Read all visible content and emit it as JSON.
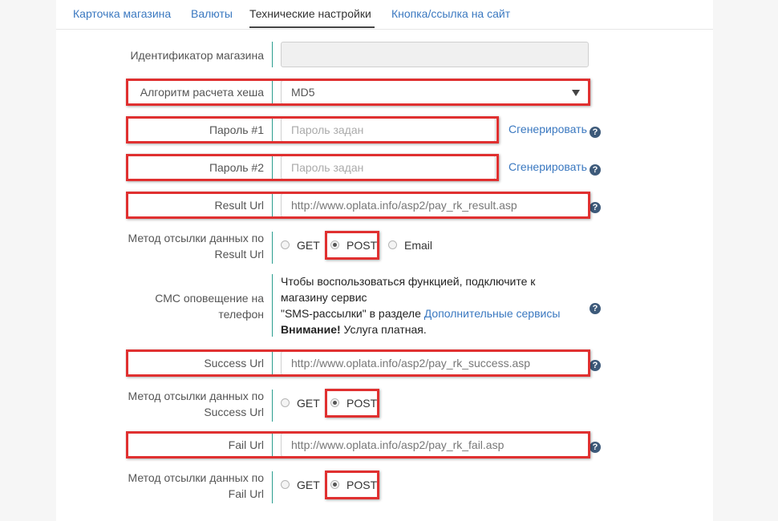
{
  "tabs": [
    "Карточка магазина",
    "Валюты",
    "Технические настройки",
    "Кнопка/ссылка на сайт"
  ],
  "fields": {
    "shop_id": {
      "label": "Идентификатор магазина",
      "value": ""
    },
    "hash_algo": {
      "label": "Алгоритм расчета хеша",
      "value": "MD5"
    },
    "password1": {
      "label": "Пароль #1",
      "placeholder": "Пароль задан",
      "generate": "Сгенерировать"
    },
    "password2": {
      "label": "Пароль #2",
      "placeholder": "Пароль задан",
      "generate": "Сгенерировать"
    },
    "result_url": {
      "label": "Result Url",
      "value": "http://www.oplata.info/asp2/pay_rk_result.asp"
    },
    "result_method": {
      "label_line1": "Метод отсылки данных по",
      "label_line2": "Result Url",
      "options": [
        "GET",
        "POST",
        "Email"
      ],
      "selected": "POST"
    },
    "sms": {
      "label_line1": "СМС оповещение на",
      "label_line2": "телефон",
      "text_line1": "Чтобы воспользоваться функцией, подключите к",
      "text_line2": "магазину сервис",
      "text_line3_a": "\"SMS-рассылки\" в разделе ",
      "text_line3_link": "Дополнительные сервисы",
      "text_line4_bold": "Внимание!",
      "text_line4_rest": " Услуга платная."
    },
    "success_url": {
      "label": "Success Url",
      "value": "http://www.oplata.info/asp2/pay_rk_success.asp"
    },
    "success_method": {
      "label_line1": "Метод отсылки данных по",
      "label_line2": "Success Url",
      "options": [
        "GET",
        "POST"
      ],
      "selected": "POST"
    },
    "fail_url": {
      "label": "Fail Url",
      "value": "http://www.oplata.info/asp2/pay_rk_fail.asp"
    },
    "fail_method": {
      "label_line1": "Метод отсылки данных по",
      "label_line2": "Fail Url",
      "options": [
        "GET",
        "POST"
      ],
      "selected": "POST"
    }
  },
  "help_glyph": "?",
  "colors": {
    "highlight": "#e03030",
    "link": "#3a78c0",
    "accent_line": "#2a9d8f",
    "help_icon": "#3d5a7a"
  }
}
